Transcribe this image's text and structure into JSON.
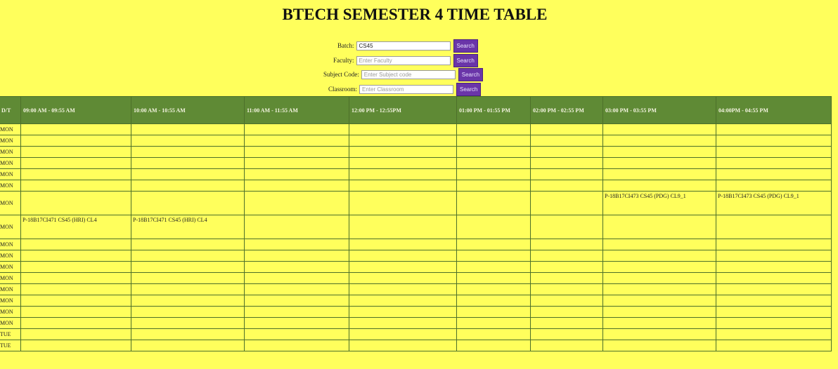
{
  "title": "BTECH SEMESTER 4 TIME TABLE",
  "form": {
    "batch": {
      "label": "Batch:",
      "value": "CS45",
      "placeholder": "",
      "button": "Search"
    },
    "faculty": {
      "label": "Faculty:",
      "value": "",
      "placeholder": "Enter Faculty",
      "button": "Search"
    },
    "subject": {
      "label": "Subject Code:",
      "value": "",
      "placeholder": "Enter Subject code",
      "button": "Search"
    },
    "classroom": {
      "label": "Classroom:",
      "value": "",
      "placeholder": "Enter Classroom",
      "button": "Search"
    }
  },
  "table": {
    "headers": [
      "D/T",
      "09:00 AM - 09:55 AM",
      "10:00 AM - 10:55 AM",
      "11:00 AM - 11:55 AM",
      "12:00 PM - 12:55PM",
      "01:00 PM - 01:55 PM",
      "02:00 PM - 02:55 PM",
      "03:00 PM - 03:55 PM",
      "04:00PM - 04:55 PM"
    ],
    "rows": [
      {
        "day": "MON",
        "cells": [
          "",
          "",
          "",
          "",
          "",
          "",
          "",
          ""
        ]
      },
      {
        "day": "MON",
        "cells": [
          "",
          "",
          "",
          "",
          "",
          "",
          "",
          ""
        ]
      },
      {
        "day": "MON",
        "cells": [
          "",
          "",
          "",
          "",
          "",
          "",
          "",
          ""
        ]
      },
      {
        "day": "MON",
        "cells": [
          "",
          "",
          "",
          "",
          "",
          "",
          "",
          ""
        ]
      },
      {
        "day": "MON",
        "cells": [
          "",
          "",
          "",
          "",
          "",
          "",
          "",
          ""
        ]
      },
      {
        "day": "MON",
        "cells": [
          "",
          "",
          "",
          "",
          "",
          "",
          "",
          ""
        ]
      },
      {
        "day": "MON",
        "tall": true,
        "cells": [
          "",
          "",
          "",
          "",
          "",
          "",
          "P-18B17CI473 CS45 (PDG) CL9_1",
          "P-18B17CI473 CS45 (PDG) CL9_1"
        ]
      },
      {
        "day": "MON",
        "tall": true,
        "cells": [
          "P-18B17CI471 CS45 (HRI) CL4",
          "P-18B17CI471 CS45 (HRI) CL4",
          "",
          "",
          "",
          "",
          "",
          ""
        ]
      },
      {
        "day": "MON",
        "cells": [
          "",
          "",
          "",
          "",
          "",
          "",
          "",
          ""
        ]
      },
      {
        "day": "MON",
        "cells": [
          "",
          "",
          "",
          "",
          "",
          "",
          "",
          ""
        ]
      },
      {
        "day": "MON",
        "cells": [
          "",
          "",
          "",
          "",
          "",
          "",
          "",
          ""
        ]
      },
      {
        "day": "MON",
        "cells": [
          "",
          "",
          "",
          "",
          "",
          "",
          "",
          ""
        ]
      },
      {
        "day": "MON",
        "cells": [
          "",
          "",
          "",
          "",
          "",
          "",
          "",
          ""
        ]
      },
      {
        "day": "MON",
        "cells": [
          "",
          "",
          "",
          "",
          "",
          "",
          "",
          ""
        ]
      },
      {
        "day": "MON",
        "cells": [
          "",
          "",
          "",
          "",
          "",
          "",
          "",
          ""
        ]
      },
      {
        "day": "MON",
        "cells": [
          "",
          "",
          "",
          "",
          "",
          "",
          "",
          ""
        ]
      },
      {
        "day": "TUE",
        "cells": [
          "",
          "",
          "",
          "",
          "",
          "",
          "",
          ""
        ]
      },
      {
        "day": "TUE",
        "cells": [
          "",
          "",
          "",
          "",
          "",
          "",
          "",
          ""
        ]
      }
    ]
  }
}
